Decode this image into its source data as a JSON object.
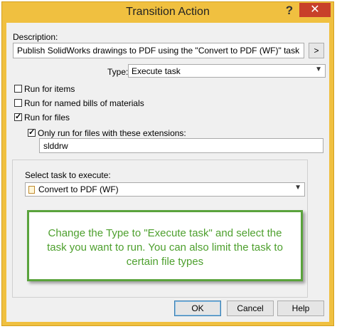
{
  "window": {
    "title": "Transition Action",
    "help_glyph": "?",
    "close_glyph": "✕"
  },
  "description": {
    "label": "Description:",
    "value": "Publish SolidWorks drawings to PDF using the \"Convert to PDF (WF)\" task",
    "browse_label": ">"
  },
  "type": {
    "label": "Type:",
    "value": "Execute task"
  },
  "checkboxes": {
    "run_items": {
      "label": "Run for items",
      "checked": false
    },
    "run_boms": {
      "label": "Run for named bills of materials",
      "checked": false
    },
    "run_files": {
      "label": "Run for files",
      "checked": true
    },
    "only_ext": {
      "label": "Only run for files with these extensions:",
      "checked": true
    }
  },
  "extensions": {
    "value": "slddrw"
  },
  "task": {
    "label": "Select task to execute:",
    "value": "Convert to PDF (WF)"
  },
  "callout": {
    "text": "Change the Type to \"Execute task\" and select the task you want to run. You can also limit the task to certain file types"
  },
  "buttons": {
    "ok": "OK",
    "cancel": "Cancel",
    "help": "Help"
  },
  "colors": {
    "title_bar": "#f0c040",
    "close_button": "#c8402a",
    "callout_border": "#5aa33c",
    "callout_text": "#4ea02e"
  }
}
